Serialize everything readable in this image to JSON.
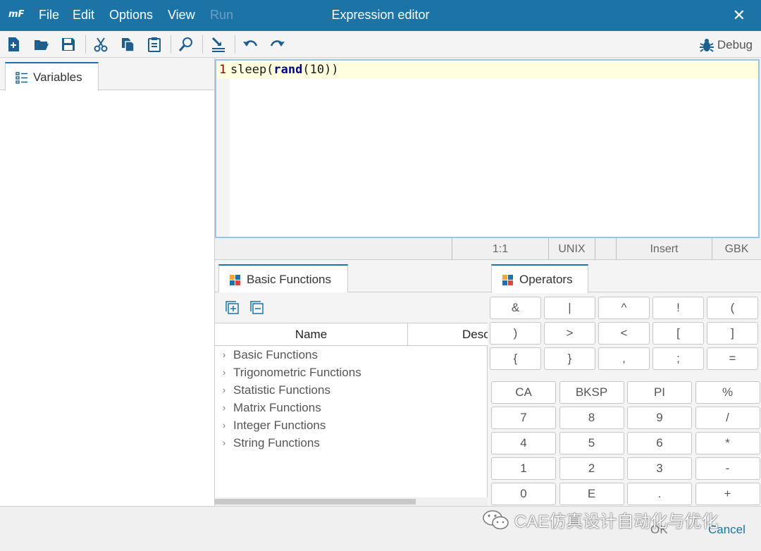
{
  "titlebar": {
    "logo": "mF",
    "menu": [
      {
        "label": "File",
        "enabled": true
      },
      {
        "label": "Edit",
        "enabled": true
      },
      {
        "label": "Options",
        "enabled": true
      },
      {
        "label": "View",
        "enabled": true
      },
      {
        "label": "Run",
        "enabled": false
      }
    ],
    "title": "Expression editor",
    "close_icon": "close-icon",
    "color": "#1c73a6"
  },
  "toolbar": {
    "icons": [
      "new-icon",
      "open-icon",
      "save-icon",
      "cut-icon",
      "copy-icon",
      "paste-icon",
      "find-icon",
      "insert-icon",
      "undo-icon",
      "redo-icon"
    ],
    "debug_label": "Debug",
    "debug_icon": "bug-icon"
  },
  "variables_panel": {
    "tab_label": "Variables",
    "tab_icon": "list-icon"
  },
  "editor": {
    "line_number": "1",
    "code_prefix": "sleep(",
    "code_keyword": "rand",
    "code_suffix": "(10))"
  },
  "statusbar": {
    "position": "1:1",
    "line_ending": "UNIX",
    "mode": "Insert",
    "encoding": "GBK"
  },
  "functions_panel": {
    "tab_label": "Basic Functions",
    "tab_icon": "function-library-icon",
    "tools": [
      "expand-all-icon",
      "collapse-all-icon"
    ],
    "columns": [
      "Name",
      "Description"
    ],
    "tree": [
      "Basic Functions",
      "Trigonometric Functions",
      "Statistic Functions",
      "Matrix Functions",
      "Integer Functions",
      "String Functions"
    ]
  },
  "operators_panel": {
    "tab_label": "Operators",
    "tab_icon": "function-library-icon",
    "operators": [
      [
        "&",
        "|",
        "^",
        "!",
        "("
      ],
      [
        ")",
        ">",
        "<",
        "[",
        "]"
      ],
      [
        "{",
        "}",
        ",",
        ";",
        "="
      ]
    ],
    "keypad": [
      [
        "CA",
        "BKSP",
        "PI",
        "%"
      ],
      [
        "7",
        "8",
        "9",
        "/"
      ],
      [
        "4",
        "5",
        "6",
        "*"
      ],
      [
        "1",
        "2",
        "3",
        "-"
      ],
      [
        "0",
        "E",
        ".",
        "+"
      ]
    ]
  },
  "buttons": {
    "ok": "OK",
    "cancel": "Cancel"
  },
  "watermark": {
    "text": "CAE仿真设计自动化与优化",
    "icon": "wechat-icon"
  }
}
